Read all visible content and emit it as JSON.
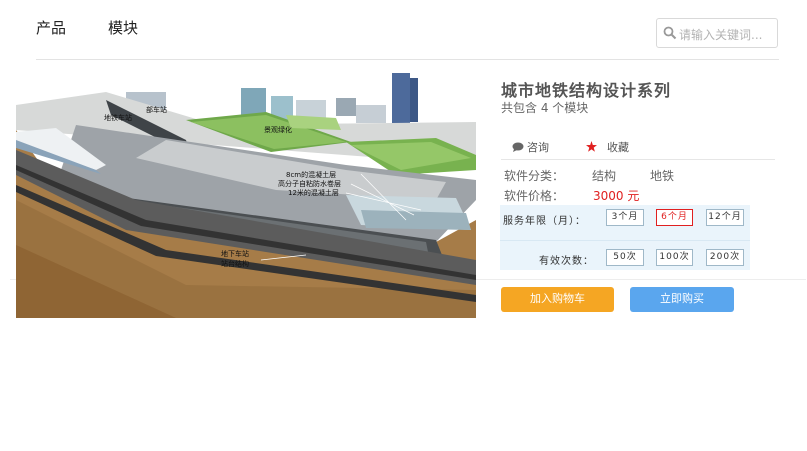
{
  "nav": {
    "items": [
      "产品",
      "模块"
    ]
  },
  "search": {
    "placeholder": "请输入关键词..."
  },
  "product": {
    "title": "城市地铁结构设计系列",
    "subtitle": "共包含 4 个模块",
    "actions": {
      "consult": "咨询",
      "favorite": "收藏"
    },
    "category_label": "软件分类：",
    "category_values": [
      "结构",
      "地铁"
    ],
    "price_label": "软件价格：",
    "price_value": "3000 元"
  },
  "service": {
    "period_label": "服务年限（月）：",
    "period_options": [
      "3个月",
      "6个月",
      "12个月"
    ],
    "period_selected": "6个月",
    "count_label": "有效次数：",
    "count_options": [
      "50次",
      "100次",
      "200次"
    ]
  },
  "image_callouts": [
    "部车站",
    "地铁车站",
    "景观绿化",
    "8cm的混凝土层",
    "高分子自粘防水卷层",
    "12米的混凝土层",
    "地下车站",
    "站台结构"
  ],
  "buttons": {
    "add_to_cart": "加入购物车",
    "buy_now": "立即购买"
  },
  "colors": {
    "accent_red": "#e02020",
    "cart_button": "#f5a623",
    "buy_button": "#5aa6ee"
  }
}
